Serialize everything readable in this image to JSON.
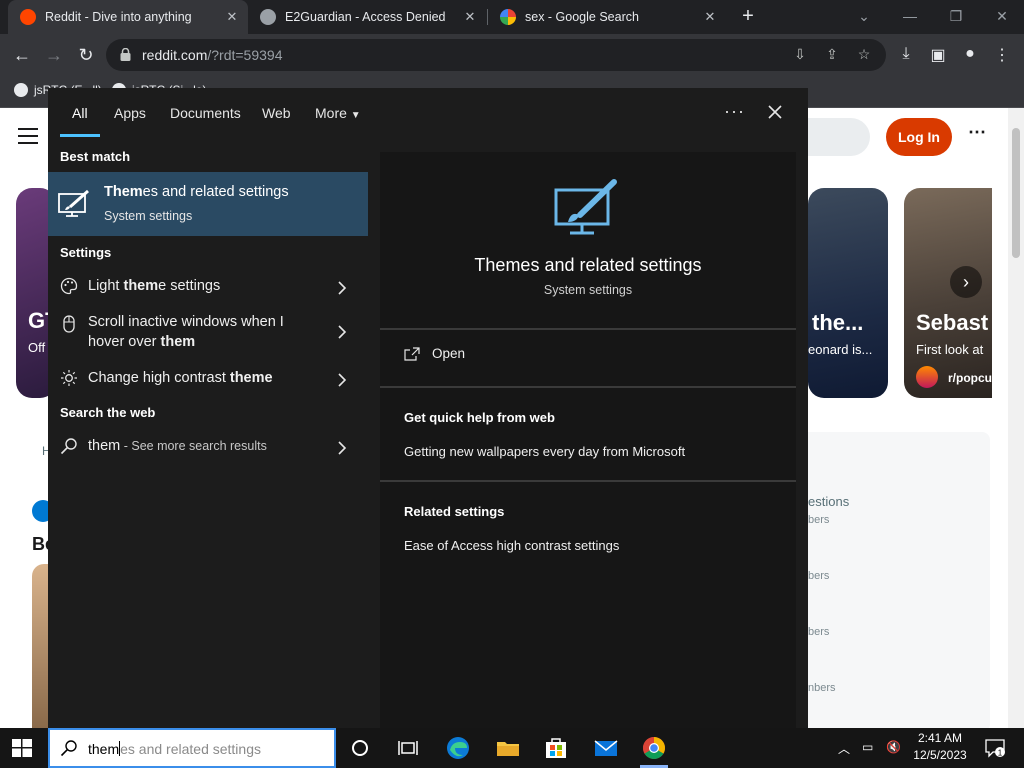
{
  "browser": {
    "tabs": [
      {
        "title": "Reddit - Dive into anything",
        "favicon_color": "#ff4500",
        "active": true,
        "close": "✕"
      },
      {
        "title": "E2Guardian - Access Denied",
        "favicon_color": "#9aa0a6",
        "active": false,
        "close": "✕"
      },
      {
        "title": "sex - Google Search",
        "favicon_color": "#4285f4",
        "active": false,
        "close": "✕"
      }
    ],
    "new_tab": "+",
    "url_host": "reddit.com",
    "url_path": "/?rdt=59394",
    "bookmarks": [
      "jsRTC (E...ll)",
      "jsRTC (Si...le)"
    ]
  },
  "reddit": {
    "login_label": "Log In",
    "more_label": "⋯",
    "cards": [
      {
        "title": "GT",
        "sub": "Off"
      },
      {
        "title": "the...",
        "sub": "eonard is..."
      },
      {
        "title": "Sebast",
        "sub": "First look at",
        "community": "r/popcu"
      }
    ],
    "sidebar_lines": [
      "estions",
      "bers",
      "bers",
      "bers",
      "nbers"
    ],
    "left_fragments": [
      "H",
      "Be"
    ]
  },
  "search": {
    "tabs": [
      "All",
      "Apps",
      "Documents",
      "Web",
      "More"
    ],
    "more_dots": "···",
    "best_match_heading": "Best match",
    "best_match": {
      "title_bold": "Them",
      "title_rest": "es and related settings",
      "sub": "System settings"
    },
    "settings_heading": "Settings",
    "settings_items": [
      {
        "pre": "Light ",
        "bold": "them",
        "post": "e settings",
        "icon": "palette-icon"
      },
      {
        "pre": "Scroll inactive windows when I hover over ",
        "bold": "them",
        "post": "",
        "icon": "mouse-icon"
      },
      {
        "pre": "Change high contrast ",
        "bold": "theme",
        "post": "",
        "icon": "brightness-icon"
      }
    ],
    "web_heading": "Search the web",
    "web_item": {
      "query": "them",
      "suffix": " - See more search results"
    },
    "preview": {
      "title": "Themes and related settings",
      "sub": "System settings",
      "open_label": "Open",
      "help_heading": "Get quick help from web",
      "help_link": "Getting new wallpapers every day from Microsoft",
      "related_heading": "Related settings",
      "related_link": "Ease of Access high contrast settings"
    }
  },
  "taskbar": {
    "search_typed": "them",
    "search_ghost": "es and related settings",
    "time": "2:41 AM",
    "date": "12/5/2023",
    "notification_count": "1"
  }
}
